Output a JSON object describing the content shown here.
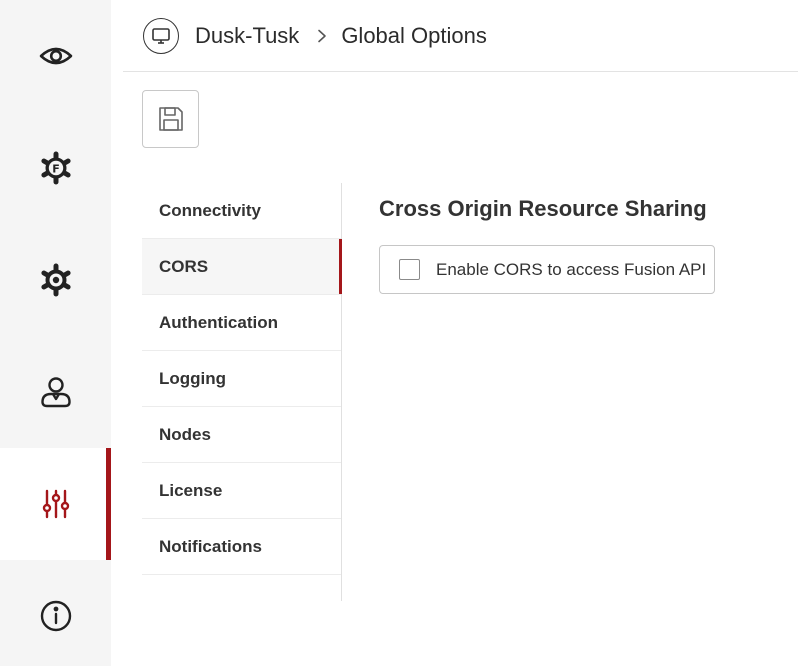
{
  "rail": {
    "items": [
      {
        "name": "eye-icon",
        "active": false
      },
      {
        "name": "fusion-gear-icon",
        "active": false
      },
      {
        "name": "gear-icon",
        "active": false
      },
      {
        "name": "user-icon",
        "active": false
      },
      {
        "name": "sliders-icon",
        "active": true
      },
      {
        "name": "info-icon",
        "active": false
      }
    ],
    "accent_color": "#a4161a"
  },
  "header": {
    "app_icon": "monitor-icon",
    "app_name": "Dusk-Tusk",
    "separator_icon": "chevron-right-icon",
    "page_title": "Global Options"
  },
  "toolbar": {
    "save_icon": "floppy-disk-icon"
  },
  "settings_nav": {
    "items": [
      {
        "label": "Connectivity",
        "active": false
      },
      {
        "label": "CORS",
        "active": true
      },
      {
        "label": "Authentication",
        "active": false
      },
      {
        "label": "Logging",
        "active": false
      },
      {
        "label": "Nodes",
        "active": false
      },
      {
        "label": "License",
        "active": false
      },
      {
        "label": "Notifications",
        "active": false
      }
    ]
  },
  "content": {
    "section_title": "Cross Origin Resource Sharing",
    "cors_checkbox": {
      "label": "Enable CORS to access Fusion API",
      "checked": false
    }
  }
}
